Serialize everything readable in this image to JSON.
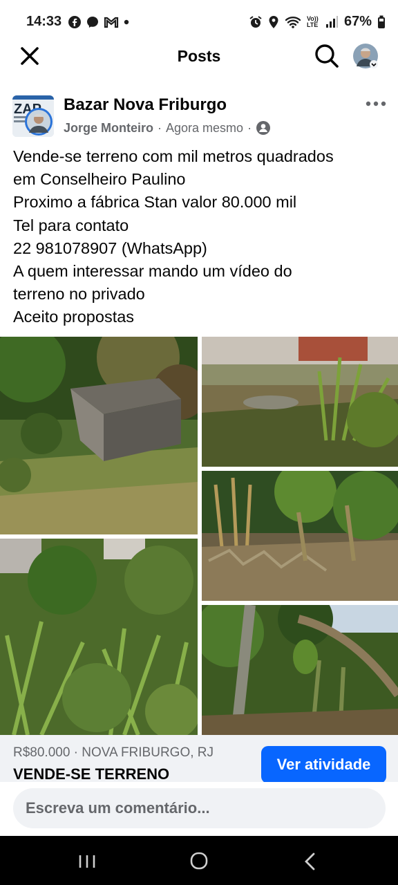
{
  "status_bar": {
    "time": "14:33",
    "left_icons": [
      "facebook-icon",
      "messenger-icon",
      "gmail-icon",
      "dot-icon"
    ],
    "right_icons": [
      "alarm-icon",
      "location-icon",
      "wifi-icon",
      "volte-icon",
      "signal-icon",
      "battery-icon"
    ],
    "volte_label": "Vo)) LTE",
    "battery": "67%"
  },
  "nav": {
    "title": "Posts",
    "close_icon": "close-icon",
    "search_icon": "search-icon"
  },
  "post": {
    "group_name": "Bazar Nova Friburgo",
    "group_avatar_text": "ZAP",
    "author": "Jorge Monteiro",
    "separator": "·",
    "time": "Agora mesmo",
    "privacy_icon": "members-icon",
    "text_lines": [
      "Vende-se terreno com mil metros quadrados",
      "em Conselheiro Paulino",
      "Proximo a fábrica Stan  valor 80.000 mil",
      "Tel para contato",
      "22 981078907 (WhatsApp)",
      "A quem interessar mando um vídeo do",
      "terreno no privado",
      "Aceito propostas"
    ]
  },
  "listing": {
    "price_location": "R$80.000 · NOVA FRIBURGO, RJ",
    "title": "VENDE-SE TERRENO",
    "action_label": "Ver atividade"
  },
  "comment": {
    "placeholder": "Escreva um comentário..."
  },
  "colors": {
    "accent": "#0866ff",
    "secondary_text": "#65676b",
    "listing_bg": "#f0f2f5"
  }
}
